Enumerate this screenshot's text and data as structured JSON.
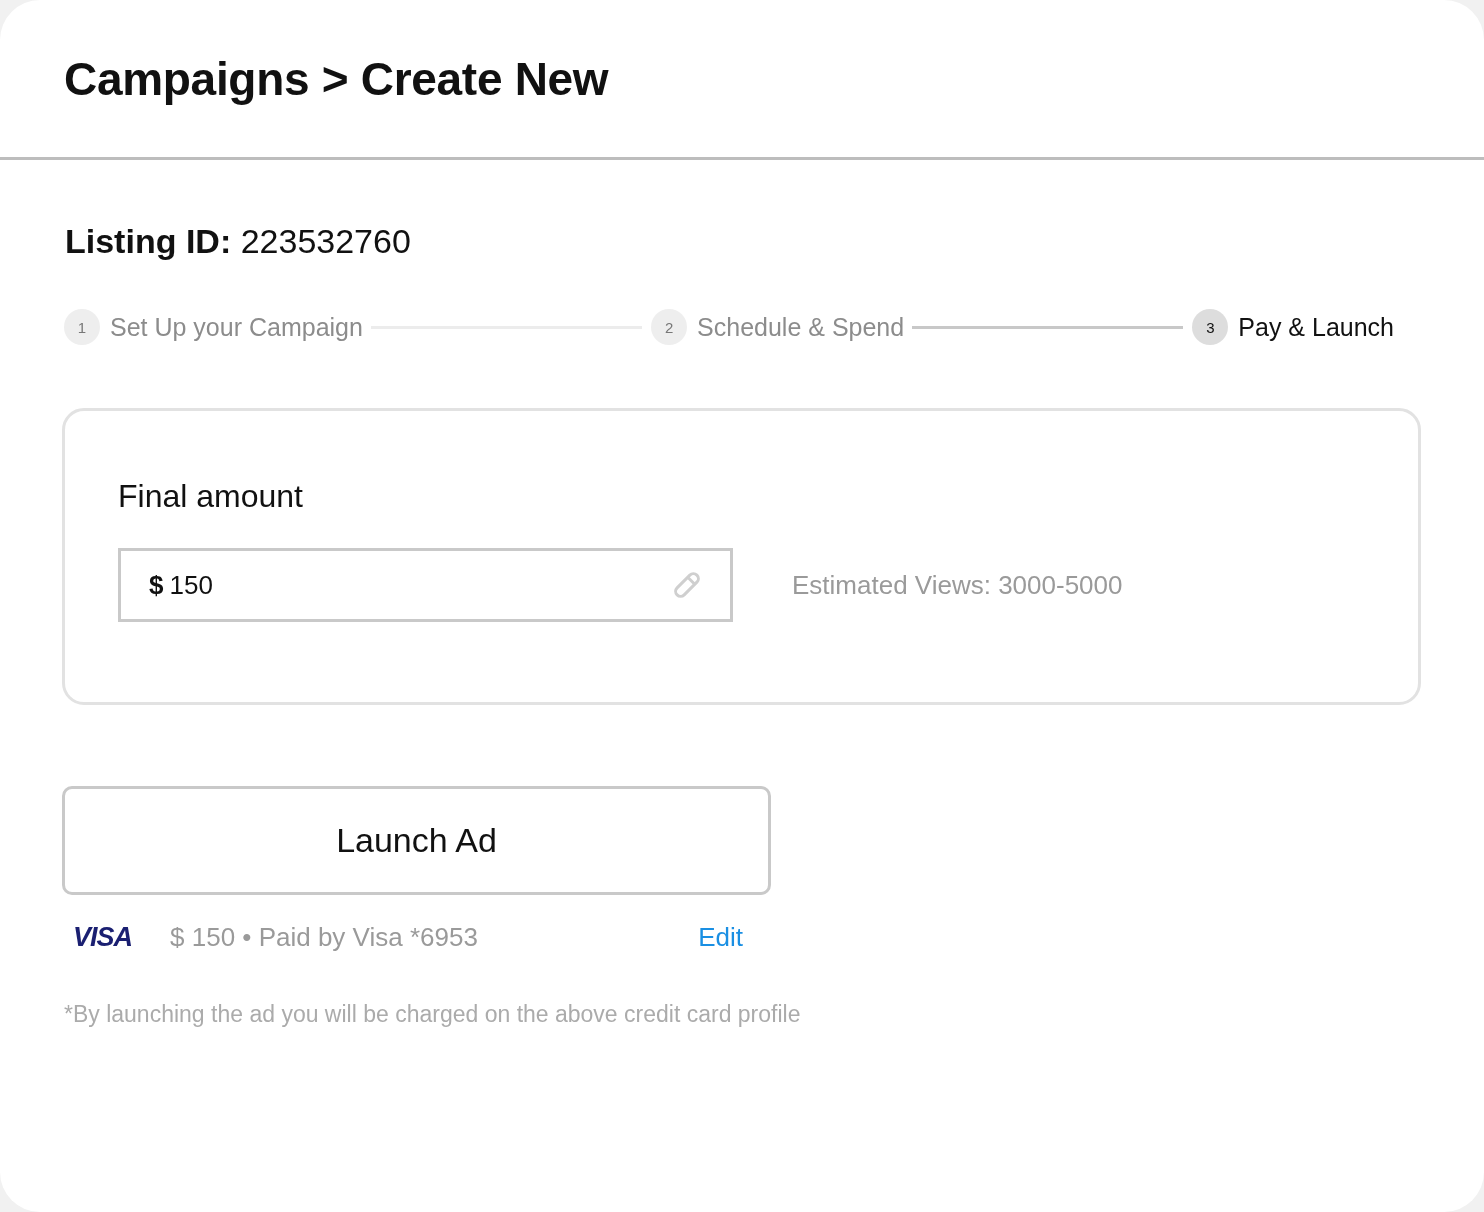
{
  "header": {
    "title": "Campaigns > Create New"
  },
  "listing": {
    "text": "**Listing ID:** 223532760"
  },
  "steps": [
    {
      "number": "1",
      "label": "Set Up your Campaign",
      "selected": false
    },
    {
      "number": "2",
      "label": "Schedule & Spend",
      "selected": false
    },
    {
      "number": "3",
      "label": "Pay & Launch",
      "selected": true
    }
  ],
  "final_amount": {
    "heading": "Final amount",
    "field": {
      "currency": "$",
      "value": "150"
    },
    "estimate": "Estimated Views: 3000-5000"
  },
  "launch_button": {
    "label": "Launch Ad"
  },
  "payment": {
    "card_brand": "VISA",
    "summary": "$ 150 • Paid by Visa *6953",
    "edit_link": "Edit"
  },
  "disclaimer": "*By launching the ad you will be charged on the above credit card profile"
}
